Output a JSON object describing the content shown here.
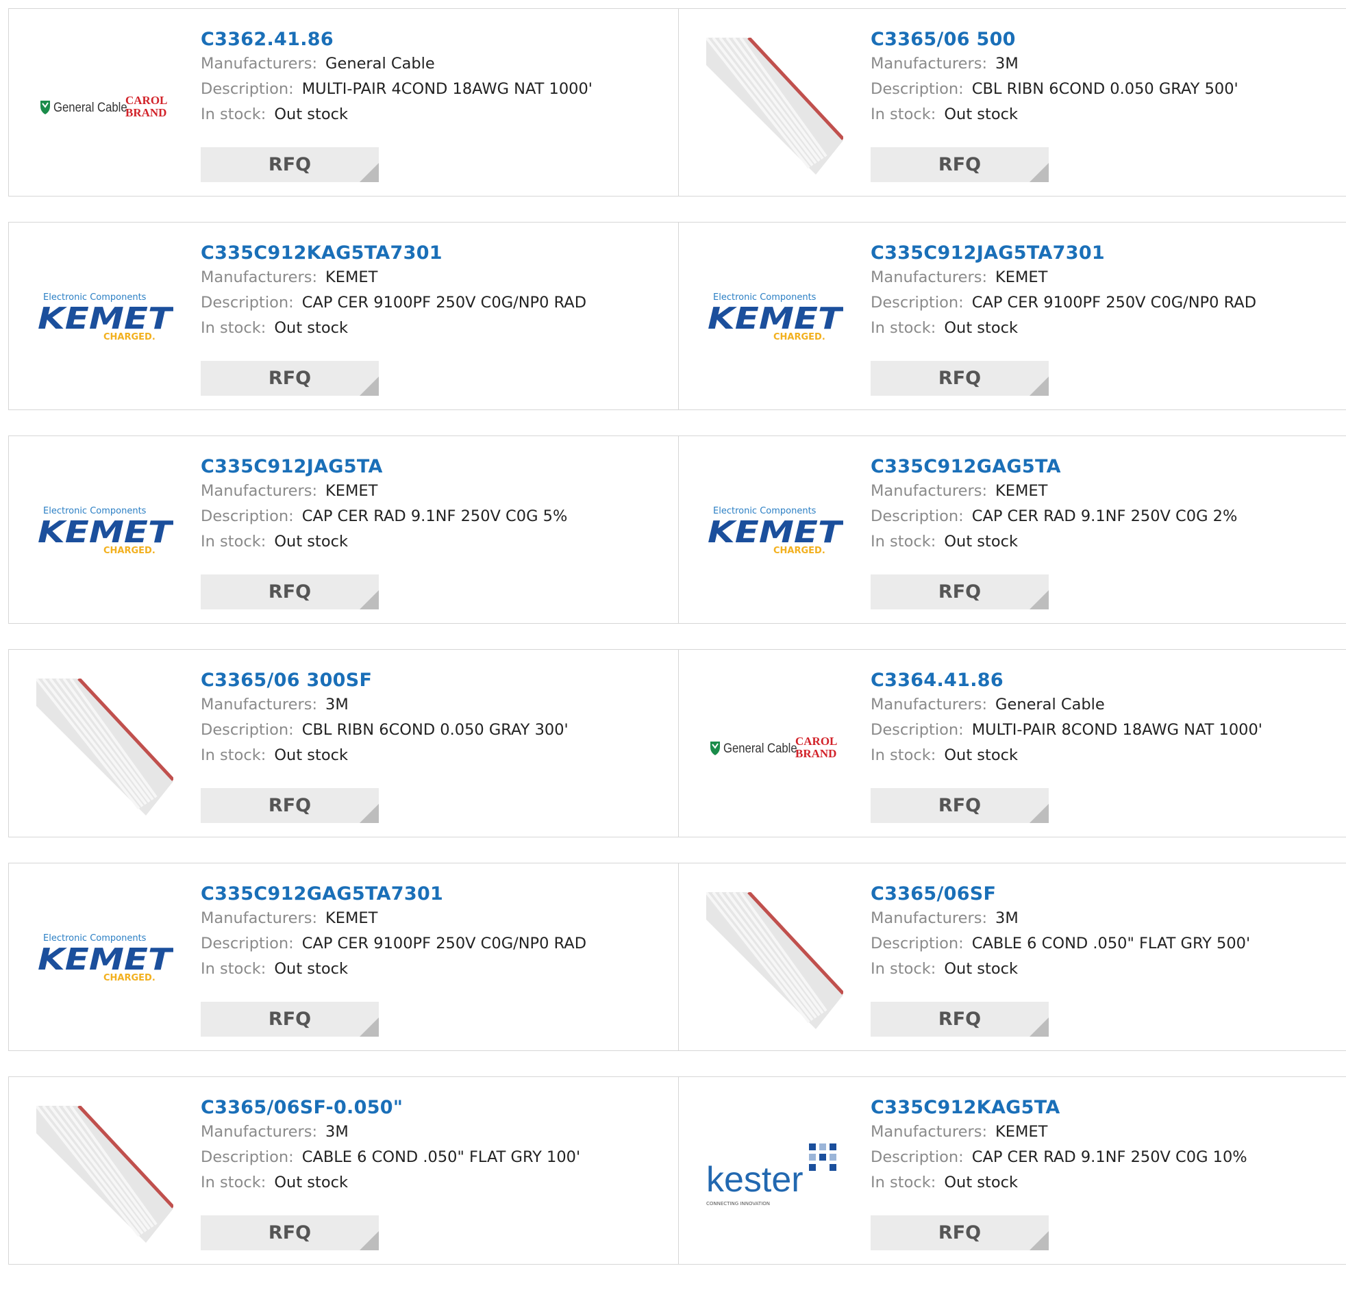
{
  "labels": {
    "manufacturers": "Manufacturers:",
    "description": "Description:",
    "stock": "In stock:",
    "rfq": "RFQ"
  },
  "logo_text": {
    "general_cable": "General Cable",
    "carol_top": "CAROL",
    "carol_bottom": "BRAND",
    "kemet_top": "Electronic Components",
    "kemet": "KEMET",
    "kemet_bottom": "CHARGED.",
    "kester": "kester",
    "kester_tag": "CONNECTING INNOVATION"
  },
  "colors": {
    "part_link": "#1a6fb8",
    "kemet_blue": "#1b4f9c",
    "kemet_yellow": "#f2b01e",
    "carol_red": "#d2232a",
    "general_cable_green": "#1a8c4a",
    "ribbon_stripe": "#c0504d",
    "rfq_bg": "#ebebeb"
  },
  "products": [
    {
      "part": "C3362.41.86",
      "manufacturer": "General Cable",
      "description": "MULTI-PAIR 4COND 18AWG NAT 1000'",
      "stock": "Out stock",
      "image": "general-cable-logo"
    },
    {
      "part": "C3365/06 500",
      "manufacturer": "3M",
      "description": "CBL RIBN 6COND 0.050 GRAY 500'",
      "stock": "Out stock",
      "image": "ribbon-cable"
    },
    {
      "part": "C335C912KAG5TA7301",
      "manufacturer": "KEMET",
      "description": "CAP CER 9100PF 250V C0G/NP0 RAD",
      "stock": "Out stock",
      "image": "kemet-logo"
    },
    {
      "part": "C335C912JAG5TA7301",
      "manufacturer": "KEMET",
      "description": "CAP CER 9100PF 250V C0G/NP0 RAD",
      "stock": "Out stock",
      "image": "kemet-logo"
    },
    {
      "part": "C335C912JAG5TA",
      "manufacturer": "KEMET",
      "description": "CAP CER RAD 9.1NF 250V C0G 5%",
      "stock": "Out stock",
      "image": "kemet-logo"
    },
    {
      "part": "C335C912GAG5TA",
      "manufacturer": "KEMET",
      "description": "CAP CER RAD 9.1NF 250V C0G 2%",
      "stock": "Out stock",
      "image": "kemet-logo"
    },
    {
      "part": "C3365/06 300SF",
      "manufacturer": "3M",
      "description": "CBL RIBN 6COND 0.050 GRAY 300'",
      "stock": "Out stock",
      "image": "ribbon-cable"
    },
    {
      "part": "C3364.41.86",
      "manufacturer": "General Cable",
      "description": "MULTI-PAIR 8COND 18AWG NAT 1000'",
      "stock": "Out stock",
      "image": "general-cable-logo"
    },
    {
      "part": "C335C912GAG5TA7301",
      "manufacturer": "KEMET",
      "description": "CAP CER 9100PF 250V C0G/NP0 RAD",
      "stock": "Out stock",
      "image": "kemet-logo"
    },
    {
      "part": "C3365/06SF",
      "manufacturer": "3M",
      "description": "CABLE 6 COND .050\" FLAT GRY 500'",
      "stock": "Out stock",
      "image": "ribbon-cable"
    },
    {
      "part": "C3365/06SF-0.050\"",
      "manufacturer": "3M",
      "description": "CABLE 6 COND .050\" FLAT GRY 100'",
      "stock": "Out stock",
      "image": "ribbon-cable"
    },
    {
      "part": "C335C912KAG5TA",
      "manufacturer": "KEMET",
      "description": "CAP CER RAD 9.1NF 250V C0G 10%",
      "stock": "Out stock",
      "image": "kester-logo"
    }
  ]
}
